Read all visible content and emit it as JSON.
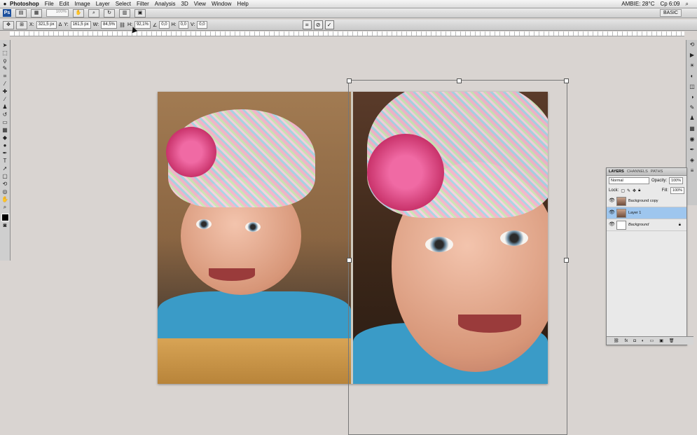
{
  "menubar": {
    "apple": "",
    "app": "Photoshop",
    "menus": [
      "File",
      "Edit",
      "Image",
      "Layer",
      "Select",
      "Filter",
      "Analysis",
      "3D",
      "View",
      "Window",
      "Help"
    ],
    "status": "AMBIE: 28°C",
    "clock": "Ср 6:09"
  },
  "appbar": {
    "ps": "Ps",
    "zoom": "100%",
    "workspace": "BASIC"
  },
  "options": {
    "x_label": "X:",
    "x_value": "321,5 px",
    "y_label": "Y:",
    "y_value": "161,5 px",
    "w_label": "W:",
    "w_value": "84,5%",
    "h_label": "H:",
    "h_value": "92,1%",
    "rot_value": "0,0",
    "hskew_label": "H:",
    "hskew_value": "0,0",
    "vskew_label": "V:",
    "vskew_value": "0,0"
  },
  "layers": {
    "tab_layers": "LAYERS",
    "tab_channels": "CHANNELS",
    "tab_paths": "PATHS",
    "blend_mode": "Normal",
    "opacity_label": "Opacity:",
    "opacity_value": "100%",
    "lock_label": "Lock:",
    "fill_label": "Fill:",
    "fill_value": "100%",
    "items": [
      {
        "name": "Background copy"
      },
      {
        "name": "Layer 1"
      },
      {
        "name": "Background"
      }
    ]
  }
}
